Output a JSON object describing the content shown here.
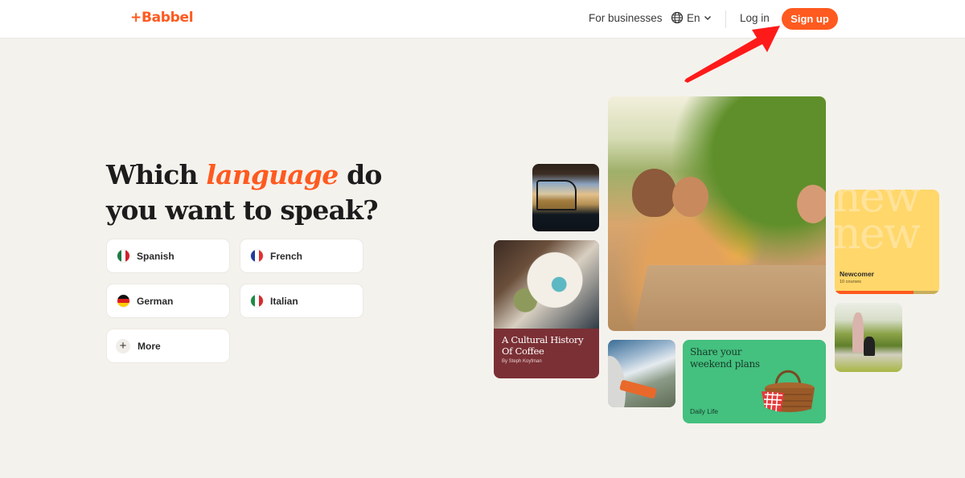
{
  "header": {
    "logo": "+Babbel",
    "for_businesses": "For businesses",
    "language_selector": {
      "icon": "globe-icon",
      "value": "En",
      "chevron": "chevron-down-icon"
    },
    "login": "Log in",
    "signup": "Sign up"
  },
  "hero": {
    "headline_prefix": "Which ",
    "headline_accent": "language",
    "headline_mid": " do",
    "headline_line2": "you want to speak?",
    "languages": [
      {
        "label": "Spanish",
        "flag": "mexico-flag-icon"
      },
      {
        "label": "French",
        "flag": "france-flag-icon"
      },
      {
        "label": "German",
        "flag": "germany-flag-icon"
      },
      {
        "label": "Italian",
        "flag": "italy-flag-icon"
      },
      {
        "label": "More",
        "icon": "plus-icon"
      }
    ]
  },
  "collage": {
    "coffee_card": {
      "title_line1": "A Cultural History",
      "title_line2": "Of Coffee",
      "author": "By Steph Koyfman"
    },
    "daily_card": {
      "title_line1": "Share your",
      "title_line2": "weekend plans",
      "category": "Daily Life"
    },
    "newcomer_card": {
      "ghost_text_1": "new",
      "ghost_text_2": "new",
      "name": "Newcomer",
      "count": "10 courses",
      "progress": 0.75
    }
  },
  "colors": {
    "brand": "#ff5a1f",
    "background": "#f4f2ed",
    "coffee_card": "#7b3035",
    "daily_card": "#44c07f",
    "newcomer_card": "#ffd76a",
    "annotation": "#ff1a1a"
  }
}
